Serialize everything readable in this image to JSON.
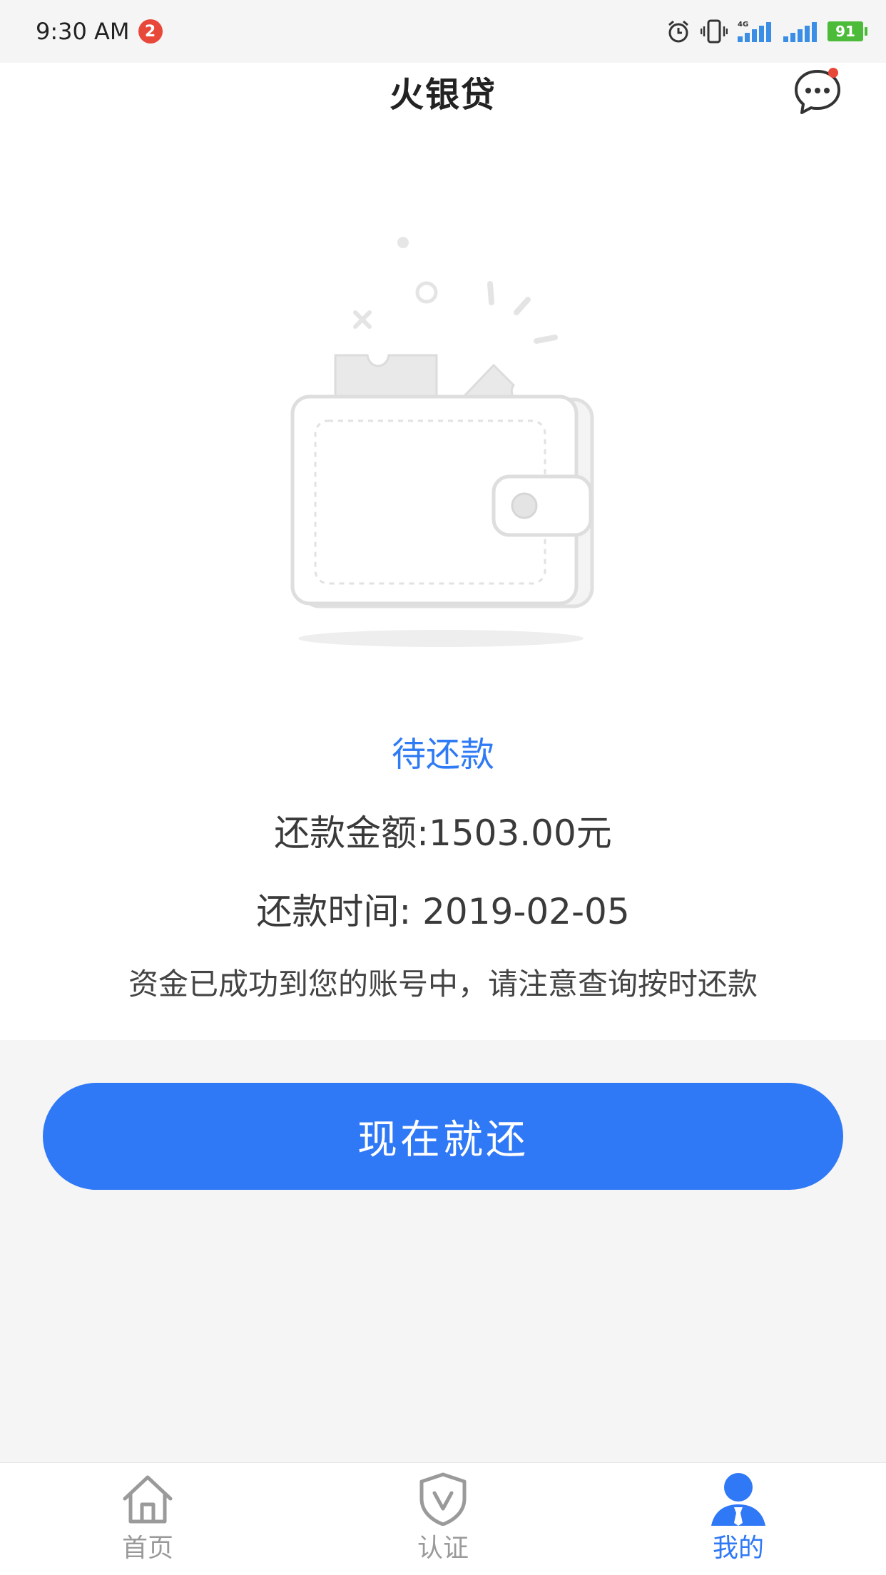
{
  "status_bar": {
    "time": "9:30 AM",
    "notification_count": "2",
    "network_label": "4G",
    "battery": "91",
    "icons": [
      "alarm-icon",
      "vibrate-icon",
      "signal-icon",
      "signal-icon",
      "battery-icon"
    ]
  },
  "header": {
    "title": "火银贷",
    "message_icon": "chat-bubble-icon"
  },
  "loan": {
    "illustration": "wallet-illustration",
    "status": "待还款",
    "amount_line": "还款金额:1503.00元",
    "date_line": "还款时间: 2019-02-05",
    "notice": "资金已成功到您的账号中，请注意查询按时还款"
  },
  "actions": {
    "repay_label": "现在就还"
  },
  "tabs": [
    {
      "label": "首页",
      "icon": "home-icon",
      "active": false
    },
    {
      "label": "认证",
      "icon": "shield-v-icon",
      "active": false
    },
    {
      "label": "我的",
      "icon": "user-icon",
      "active": true
    }
  ],
  "colors": {
    "accent": "#2f78f6",
    "status_text": "#2f7bf5",
    "badge": "#e8483a",
    "battery": "#4cbb3a",
    "inactive_tab": "#9a9a9a"
  }
}
